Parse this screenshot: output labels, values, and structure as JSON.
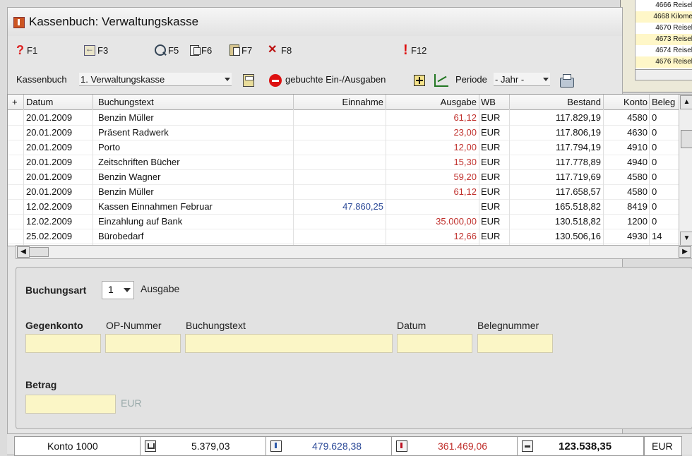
{
  "background_list": {
    "rows": [
      "4666 Reisel",
      "4668 Kilome",
      "4670 Reisel",
      "4673 Reisel",
      "4674 Reisel",
      "4676 Reisel"
    ]
  },
  "window": {
    "title": "Kassenbuch: Verwaltungskasse"
  },
  "toolbar": {
    "f1": "F1",
    "f3": "F3",
    "f5": "F5",
    "f6": "F6",
    "f7": "F7",
    "f8": "F8",
    "f12": "F12"
  },
  "filter": {
    "label": "Kassenbuch",
    "kasse_value": "1. Verwaltungskasse",
    "booked_label": "gebuchte Ein-/Ausgaben",
    "periode_label": "Periode",
    "periode_value": "- Jahr -"
  },
  "grid": {
    "headers": {
      "plus": "+",
      "datum": "Datum",
      "buchungstext": "Buchungstext",
      "einnahme": "Einnahme",
      "ausgabe": "Ausgabe",
      "wb": "WB",
      "bestand": "Bestand",
      "konto": "Konto",
      "beleg": "Beleg"
    },
    "rows": [
      {
        "datum": "20.01.2009",
        "text": "Benzin Müller",
        "einnahme": "",
        "ausgabe": "61,12",
        "wb": "EUR",
        "bestand": "117.829,19",
        "konto": "4580",
        "beleg": "0"
      },
      {
        "datum": "20.01.2009",
        "text": "Präsent Radwerk",
        "einnahme": "",
        "ausgabe": "23,00",
        "wb": "EUR",
        "bestand": "117.806,19",
        "konto": "4630",
        "beleg": "0"
      },
      {
        "datum": "20.01.2009",
        "text": "Porto",
        "einnahme": "",
        "ausgabe": "12,00",
        "wb": "EUR",
        "bestand": "117.794,19",
        "konto": "4910",
        "beleg": "0"
      },
      {
        "datum": "20.01.2009",
        "text": "Zeitschriften  Bücher",
        "einnahme": "",
        "ausgabe": "15,30",
        "wb": "EUR",
        "bestand": "117.778,89",
        "konto": "4940",
        "beleg": "0"
      },
      {
        "datum": "20.01.2009",
        "text": "Benzin Wagner",
        "einnahme": "",
        "ausgabe": "59,20",
        "wb": "EUR",
        "bestand": "117.719,69",
        "konto": "4580",
        "beleg": "0"
      },
      {
        "datum": "20.01.2009",
        "text": "Benzin Müller",
        "einnahme": "",
        "ausgabe": "61,12",
        "wb": "EUR",
        "bestand": "117.658,57",
        "konto": "4580",
        "beleg": "0"
      },
      {
        "datum": "12.02.2009",
        "text": "Kassen Einnahmen Februar",
        "einnahme": "47.860,25",
        "ausgabe": "",
        "wb": "EUR",
        "bestand": "165.518,82",
        "konto": "8419",
        "beleg": "0"
      },
      {
        "datum": "12.02.2009",
        "text": "Einzahlung auf Bank",
        "einnahme": "",
        "ausgabe": "35.000,00",
        "wb": "EUR",
        "bestand": "130.518,82",
        "konto": "1200",
        "beleg": "0"
      },
      {
        "datum": "25.02.2009",
        "text": "Bürobedarf",
        "einnahme": "",
        "ausgabe": "12,66",
        "wb": "EUR",
        "bestand": "130.506,16",
        "konto": "4930",
        "beleg": "14"
      }
    ]
  },
  "form": {
    "buchungsart_label": "Buchungsart",
    "buchungsart_value": "1",
    "buchungsart_text": "Ausgabe",
    "gegenkonto_label": "Gegenkonto",
    "op_label": "OP-Nummer",
    "buchungstext_label": "Buchungstext",
    "datum_label": "Datum",
    "beleg_label": "Belegnummer",
    "betrag_label": "Betrag",
    "currency": "EUR"
  },
  "status": {
    "konto": "Konto  1000",
    "anfang": "5.379,03",
    "einnahmen": "479.628,38",
    "ausgaben": "361.469,06",
    "saldo": "123.538,35",
    "currency": "EUR"
  }
}
